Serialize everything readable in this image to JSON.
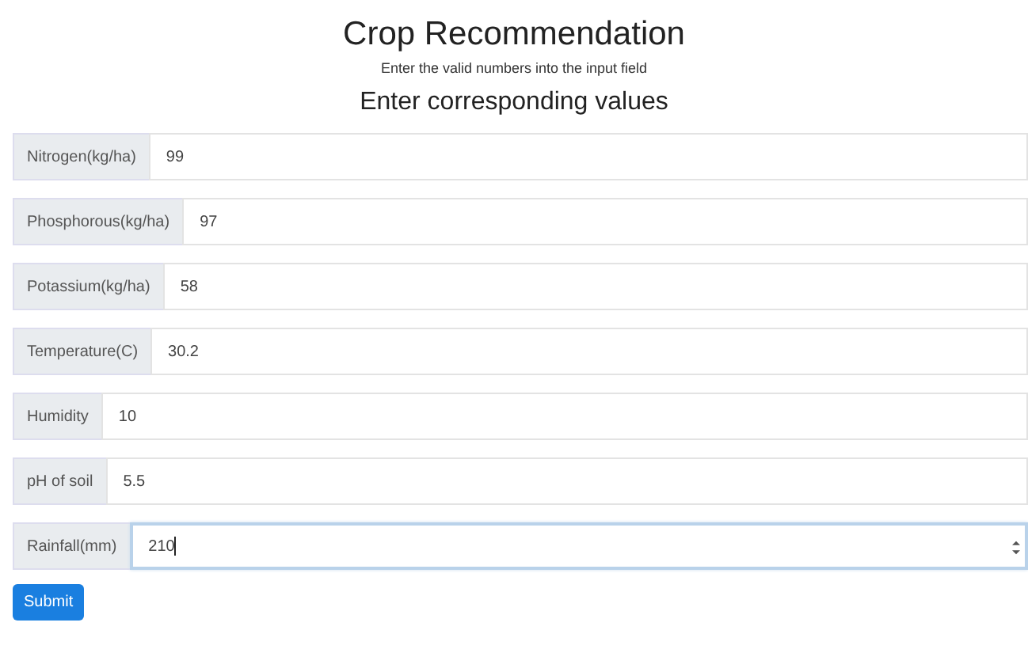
{
  "title": "Crop Recommendation",
  "subtitle": "Enter the valid numbers into the input field",
  "heading": "Enter corresponding values",
  "fields": [
    {
      "label": "Nitrogen(kg/ha)",
      "value": "99",
      "focused": false
    },
    {
      "label": "Phosphorous(kg/ha)",
      "value": "97",
      "focused": false
    },
    {
      "label": "Potassium(kg/ha)",
      "value": "58",
      "focused": false
    },
    {
      "label": "Temperature(C)",
      "value": "30.2",
      "focused": false
    },
    {
      "label": "Humidity",
      "value": "10",
      "focused": false
    },
    {
      "label": "pH of soil",
      "value": "5.5",
      "focused": false
    },
    {
      "label": "Rainfall(mm)",
      "value": "210",
      "focused": true
    }
  ],
  "submit": "Submit"
}
